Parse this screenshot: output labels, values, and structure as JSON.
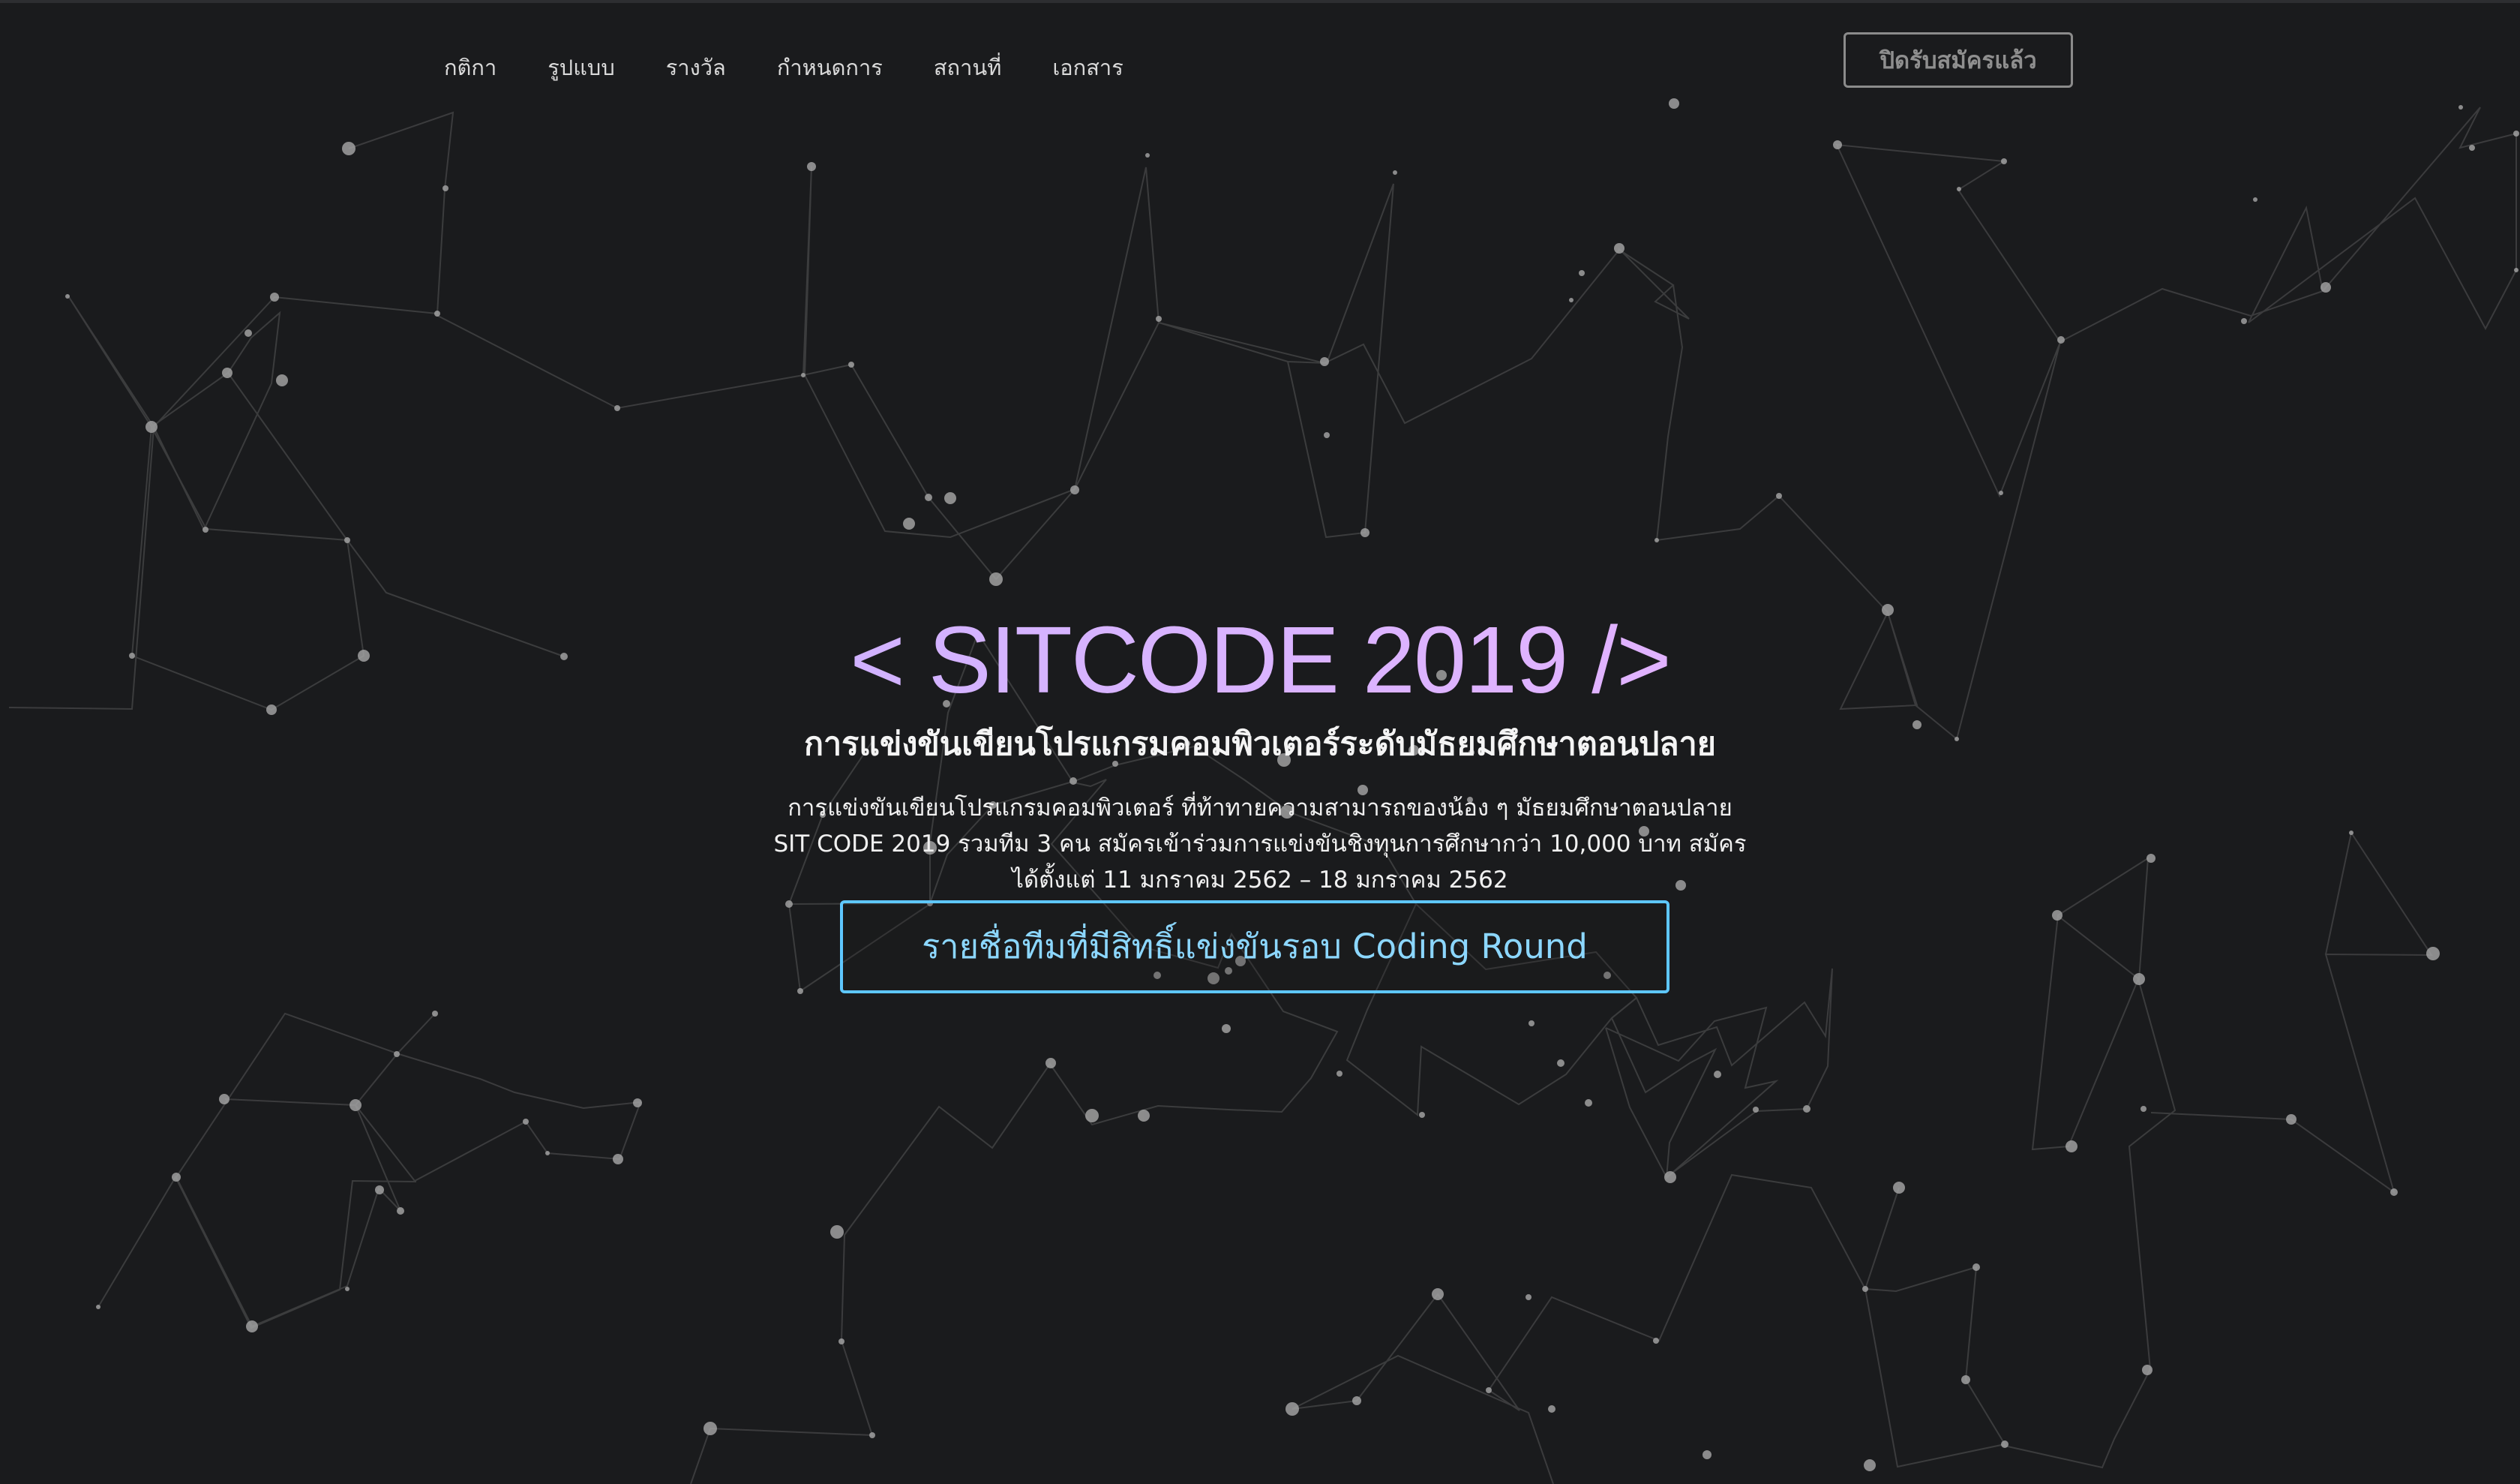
{
  "nav": {
    "items": [
      {
        "label": "กติกา"
      },
      {
        "label": "รูปแบบ"
      },
      {
        "label": "รางวัล"
      },
      {
        "label": "กำหนดการ"
      },
      {
        "label": "สถานที่"
      },
      {
        "label": "เอกสาร"
      }
    ],
    "status_button": "ปิดรับสมัครแล้ว"
  },
  "hero": {
    "title": "< SITCODE 2019 />",
    "subtitle": "การแข่งขันเขียนโปรแกรมคอมพิวเตอร์ระดับมัธยมศึกษาตอนปลาย",
    "description_line_1": "การแข่งขันเขียนโปรแกรมคอมพิวเตอร์ ที่ท้าทายความสามารถของน้อง ๆ มัธยมศึกษาตอนปลาย",
    "description_line_2": "SIT CODE 2019 รวมทีม 3 คน สมัครเข้าร่วมการแข่งขันชิงทุนการศึกษากว่า 10,000 บาท สมัคร",
    "description_line_3": "ได้ตั้งแต่ 11 มกราคม 2562 – 18 มกราคม 2562",
    "cta_label": "รายชื่อทีมที่มีสิทธิ์แข่งขันรอบ Coding Round"
  },
  "colors": {
    "background": "#1a1b1d",
    "network": "#8a8a8a",
    "title_start": "#b8a9ff",
    "title_end": "#f0b2ff",
    "cta": "#5ec7ff"
  }
}
